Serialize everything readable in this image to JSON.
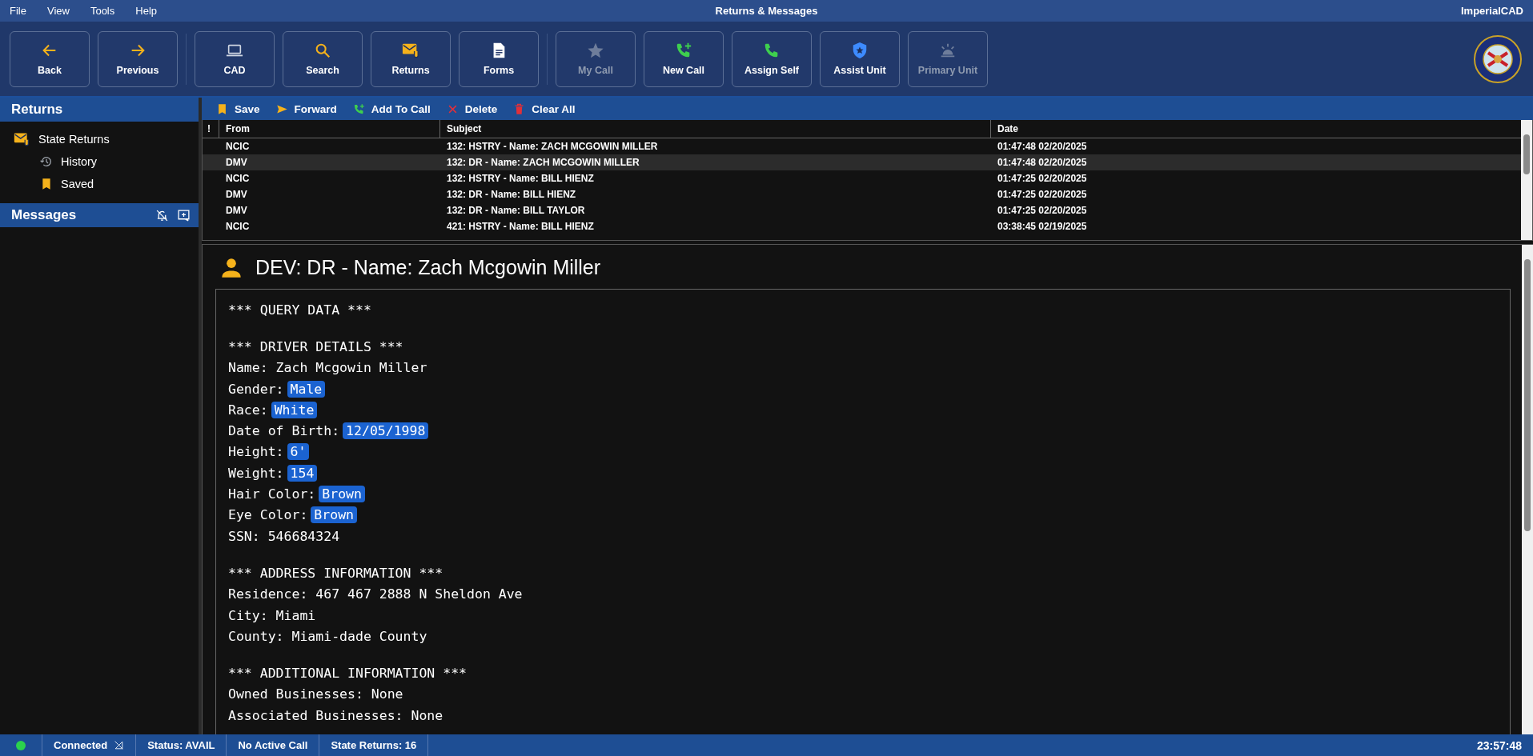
{
  "menu": [
    "File",
    "View",
    "Tools",
    "Help"
  ],
  "window": {
    "title": "Returns & Messages",
    "app_name": "ImperialCAD"
  },
  "toolbar": [
    {
      "label": "Back",
      "disabled": false
    },
    {
      "label": "Previous",
      "disabled": false
    },
    {
      "label": "CAD",
      "disabled": false
    },
    {
      "label": "Search",
      "disabled": false
    },
    {
      "label": "Returns",
      "disabled": false
    },
    {
      "label": "Forms",
      "disabled": false
    },
    {
      "label": "My Call",
      "disabled": true
    },
    {
      "label": "New Call",
      "disabled": false
    },
    {
      "label": "Assign Self",
      "disabled": false
    },
    {
      "label": "Assist Unit",
      "disabled": false
    },
    {
      "label": "Primary Unit",
      "disabled": true
    }
  ],
  "sidebar": {
    "returns_title": "Returns",
    "items": [
      {
        "label": "State Returns",
        "children": [
          {
            "label": "History"
          },
          {
            "label": "Saved"
          }
        ]
      }
    ],
    "messages_title": "Messages"
  },
  "actions": [
    "Save",
    "Forward",
    "Add To Call",
    "Delete",
    "Clear All"
  ],
  "table": {
    "columns": [
      "!",
      "From",
      "Subject",
      "Date"
    ],
    "rows": [
      {
        "from": "NCIC",
        "subject": "132: HSTRY - Name: ZACH MCGOWIN MILLER",
        "date": "01:47:48 02/20/2025",
        "selected": false
      },
      {
        "from": "DMV",
        "subject": "132: DR - Name: ZACH MCGOWIN MILLER",
        "date": "01:47:48 02/20/2025",
        "selected": true
      },
      {
        "from": "NCIC",
        "subject": "132: HSTRY - Name: BILL  HIENZ",
        "date": "01:47:25 02/20/2025",
        "selected": false
      },
      {
        "from": "DMV",
        "subject": "132: DR - Name: BILL  HIENZ",
        "date": "01:47:25 02/20/2025",
        "selected": false
      },
      {
        "from": "DMV",
        "subject": "132: DR - Name: BILL  TAYLOR",
        "date": "01:47:25 02/20/2025",
        "selected": false
      },
      {
        "from": "NCIC",
        "subject": "421: HSTRY - Name: BILL  HIENZ",
        "date": "03:38:45 02/19/2025",
        "selected": false
      }
    ]
  },
  "detail": {
    "title": "DEV: DR - Name: Zach Mcgowin Miller",
    "sections": [
      {
        "heading": "*** QUERY DATA ***"
      },
      {
        "heading": "*** DRIVER DETAILS ***",
        "lines": [
          {
            "kind": "plain",
            "text": "Name: Zach Mcgowin Miller"
          },
          {
            "kind": "badge",
            "label": "Gender:",
            "value": "Male"
          },
          {
            "kind": "badge",
            "label": "Race:",
            "value": "White"
          },
          {
            "kind": "badge",
            "label": "Date of Birth:",
            "value": "12/05/1998"
          },
          {
            "kind": "badge",
            "label": "Height:",
            "value": "6'"
          },
          {
            "kind": "badge",
            "label": "Weight:",
            "value": "154"
          },
          {
            "kind": "badge",
            "label": "Hair Color:",
            "value": "Brown"
          },
          {
            "kind": "badge",
            "label": "Eye Color:",
            "value": "Brown"
          },
          {
            "kind": "plain",
            "text": "SSN: 546684324"
          }
        ]
      },
      {
        "heading": "*** ADDRESS INFORMATION ***",
        "lines": [
          {
            "kind": "plain",
            "text": "Residence: 467 467 2888 N Sheldon Ave"
          },
          {
            "kind": "plain",
            "text": "City: Miami"
          },
          {
            "kind": "plain",
            "text": "County: Miami-dade County"
          }
        ]
      },
      {
        "heading": "*** ADDITIONAL INFORMATION ***",
        "lines": [
          {
            "kind": "plain",
            "text": "Owned Businesses: None"
          },
          {
            "kind": "plain",
            "text": "Associated Businesses: None"
          }
        ]
      }
    ]
  },
  "status_bar": {
    "connected": true,
    "connection": "Connected",
    "status": "Status: AVAIL",
    "call": "No Active Call",
    "returns": "State Returns: 16",
    "time": "23:57:48"
  }
}
